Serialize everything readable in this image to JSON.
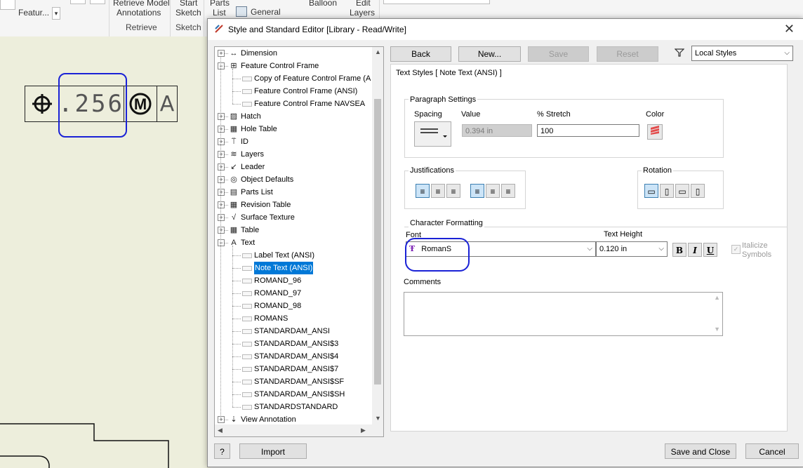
{
  "ribbon": {
    "featur_label": "Featur...",
    "retrieve_model_label": "Retrieve Model",
    "annotations_label": "Annotations",
    "retrieve_group": "Retrieve",
    "start_label": "Start",
    "sketch_label": "Sketch",
    "sketch_group": "Sketch",
    "parts_label": "Parts",
    "list_label": "List",
    "general_label": "General",
    "balloon_label": "Balloon",
    "edit_label": "Edit",
    "layers_label": "Layers"
  },
  "drawing": {
    "fcf_value": ".256",
    "fcf_modifier": "M",
    "fcf_datum": "A"
  },
  "dialog": {
    "title": "Style and Standard Editor [Library - Read/Write]",
    "close": "✕"
  },
  "tree": {
    "items": [
      {
        "label": "Dimension",
        "level": 0,
        "expander": "+"
      },
      {
        "label": "Feature Control Frame",
        "level": 0,
        "expander": "−"
      },
      {
        "label": "Copy of Feature Control Frame (A",
        "level": 1
      },
      {
        "label": "Feature Control Frame (ANSI)",
        "level": 1
      },
      {
        "label": "Feature Control Frame NAVSEA",
        "level": 1
      },
      {
        "label": "Hatch",
        "level": 0,
        "expander": "+"
      },
      {
        "label": "Hole Table",
        "level": 0,
        "expander": "+"
      },
      {
        "label": "ID",
        "level": 0,
        "expander": "+"
      },
      {
        "label": "Layers",
        "level": 0,
        "expander": "+"
      },
      {
        "label": "Leader",
        "level": 0,
        "expander": "+"
      },
      {
        "label": "Object Defaults",
        "level": 0,
        "expander": "+"
      },
      {
        "label": "Parts List",
        "level": 0,
        "expander": "+"
      },
      {
        "label": "Revision Table",
        "level": 0,
        "expander": "+"
      },
      {
        "label": "Surface Texture",
        "level": 0,
        "expander": "+"
      },
      {
        "label": "Table",
        "level": 0,
        "expander": "+"
      },
      {
        "label": "Text",
        "level": 0,
        "expander": "−"
      },
      {
        "label": "Label Text (ANSI)",
        "level": 1
      },
      {
        "label": "Note Text (ANSI)",
        "level": 1,
        "selected": true
      },
      {
        "label": "ROMAND_96",
        "level": 1
      },
      {
        "label": "ROMAND_97",
        "level": 1
      },
      {
        "label": "ROMAND_98",
        "level": 1
      },
      {
        "label": "ROMANS",
        "level": 1
      },
      {
        "label": "STANDARDAM_ANSI",
        "level": 1
      },
      {
        "label": "STANDARDAM_ANSI$3",
        "level": 1
      },
      {
        "label": "STANDARDAM_ANSI$4",
        "level": 1
      },
      {
        "label": "STANDARDAM_ANSI$7",
        "level": 1
      },
      {
        "label": "STANDARDAM_ANSI$SF",
        "level": 1
      },
      {
        "label": "STANDARDAM_ANSI$SH",
        "level": 1
      },
      {
        "label": "STANDARDSTANDARD",
        "level": 1
      },
      {
        "label": "View Annotation",
        "level": 0,
        "expander": "+"
      }
    ]
  },
  "toolbar": {
    "back": "Back",
    "new": "New...",
    "save": "Save",
    "reset": "Reset",
    "filter": "Local Styles"
  },
  "editor": {
    "heading": "Text Styles [ Note Text (ANSI) ]",
    "paragraph": {
      "title": "Paragraph Settings",
      "spacing_label": "Spacing",
      "value_label": "Value",
      "value": "0.394 in",
      "stretch_label": "% Stretch",
      "stretch": "100",
      "color_label": "Color"
    },
    "justifications": {
      "title": "Justifications"
    },
    "rotation": {
      "title": "Rotation"
    },
    "character": {
      "title": "Character Formatting",
      "font_label": "Font",
      "font": "RomanS",
      "height_label": "Text Height",
      "height": "0.120 in",
      "bold": "B",
      "italic": "I",
      "underline": "U",
      "italicize": "Italicize",
      "symbols": "Symbols"
    },
    "comments_label": "Comments",
    "comments": ""
  },
  "footer": {
    "help": "?",
    "import": "Import",
    "save_close": "Save and Close",
    "cancel": "Cancel"
  },
  "colors": {
    "accent": "#0078d7",
    "annotation_circle": "#1a22d6"
  }
}
